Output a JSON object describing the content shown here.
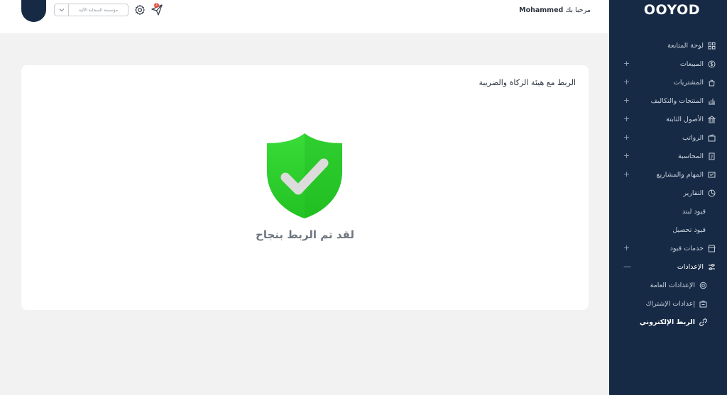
{
  "brand": {
    "logo_text": "OOYOD"
  },
  "header": {
    "welcome_text": "مرحبا بك",
    "user_name": "Mohammed",
    "company_select_value": "مؤسسة السحابة الآلية",
    "notification_count": "2"
  },
  "sidebar": {
    "items": [
      {
        "label": "لوحة المتابعة",
        "icon": "grid-icon",
        "expandable": false
      },
      {
        "label": "المبيعات",
        "icon": "dollar-circle-icon",
        "expandable": true
      },
      {
        "label": "المشتريات",
        "icon": "shopping-bag-icon",
        "expandable": true
      },
      {
        "label": "المنتجات والتكاليف",
        "icon": "products-icon",
        "expandable": true
      },
      {
        "label": "الأصول الثابتة",
        "icon": "building-icon",
        "expandable": true
      },
      {
        "label": "الرواتب",
        "icon": "wallet-icon",
        "expandable": true
      },
      {
        "label": "المحاسبة",
        "icon": "accounting-icon",
        "expandable": true
      },
      {
        "label": "المهام والمشاريع",
        "icon": "tasks-icon",
        "expandable": true
      },
      {
        "label": "التقارير",
        "icon": "pie-chart-icon",
        "expandable": false
      },
      {
        "label": "قيود لبند",
        "icon": "",
        "expandable": false
      },
      {
        "label": "قيود تحصيل",
        "icon": "",
        "expandable": false
      },
      {
        "label": "خدمات قيود",
        "icon": "store-icon",
        "expandable": true
      },
      {
        "label": "الإعدادات",
        "icon": "sliders-icon",
        "expandable": true,
        "open": true
      },
      {
        "label": "الإعدادات العامة",
        "icon": "gear-icon",
        "sub": true
      },
      {
        "label": "إعدادات الإشتراك",
        "icon": "subscription-icon",
        "sub": true
      },
      {
        "label": "الربط الإلكتروني",
        "icon": "link-icon",
        "sub": true,
        "active": true
      }
    ]
  },
  "card": {
    "title": "الربط مع هيئة الزكاة والضريبة",
    "success_message": "لقد تم الربط بنجاح"
  },
  "colors": {
    "sidebar_bg": "#162a45",
    "shield_green": "#2fd12f",
    "check_gray": "#d9d9d9"
  }
}
